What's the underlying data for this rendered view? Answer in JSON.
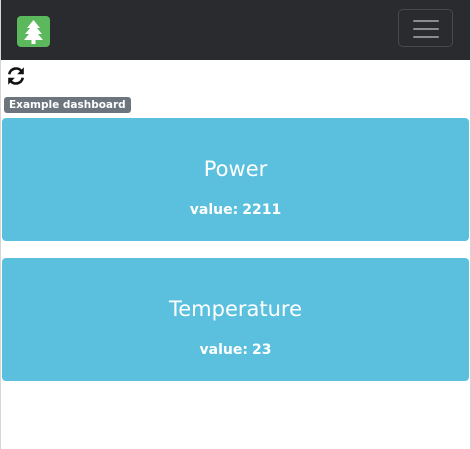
{
  "navbar": {
    "logo_icon": "pine-tree-icon",
    "toggle_icon": "hamburger-menu-icon",
    "background_color": "#292b2e",
    "logo_color": "#5cb85c"
  },
  "toolbar": {
    "refresh_icon": "refresh-icon"
  },
  "dashboard": {
    "badge_label": "Example dashboard",
    "card_color": "#5bc0de",
    "cards": [
      {
        "title": "Power",
        "value_label": "value:",
        "value": "2211"
      },
      {
        "title": "Temperature",
        "value_label": "value:",
        "value": "23"
      }
    ]
  }
}
